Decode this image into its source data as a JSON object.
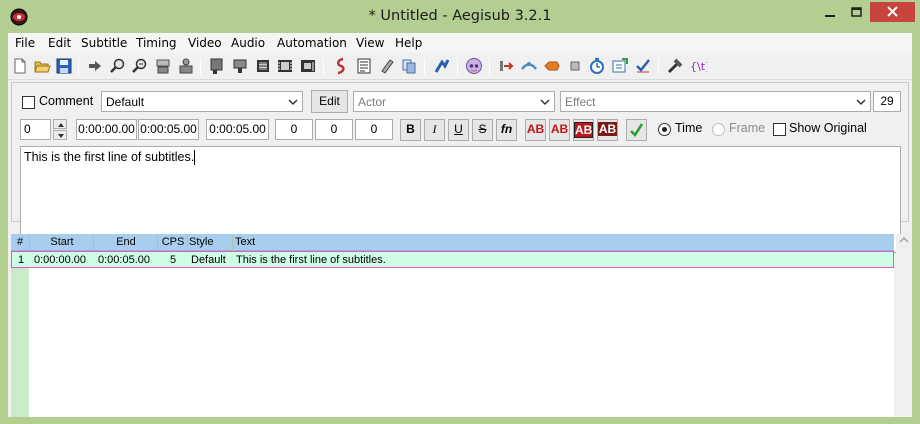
{
  "window": {
    "title": "* Untitled - Aegisub 3.2.1",
    "accent": "#b2ce91",
    "close_color": "#c7453c"
  },
  "menu": {
    "items": [
      "File",
      "Edit",
      "Subtitle",
      "Timing",
      "Video",
      "Audio",
      "Automation",
      "View",
      "Help"
    ]
  },
  "toolbar": {
    "icons": [
      "new-file-icon",
      "open-folder-icon",
      "save-icon",
      "jump-to-icon",
      "zoom-in-icon",
      "zoom-out-icon",
      "snap-start-icon",
      "snap-end-icon",
      "styles-manager-icon",
      "properties-icon",
      "attachments-icon",
      "fonts-collector-icon",
      "spell-check-icon",
      "shift-times-icon",
      "translation-icon",
      "resample-icon",
      "kanji-timer-icon",
      "visual-typesetting-icon",
      "timing-post-icon",
      "automation-icon",
      "options-icon"
    ]
  },
  "editbox": {
    "comment_label": "Comment",
    "comment_checked": false,
    "style_value": "Default",
    "edit_label": "Edit",
    "actor_placeholder": "Actor",
    "effect_placeholder": "Effect",
    "char_count": "29",
    "layer": "0",
    "start_time": "0:00:00.00",
    "end_time": "0:00:05.00",
    "duration": "0:00:05.00",
    "margin_left": "0",
    "margin_right": "0",
    "margin_vertical": "0",
    "bold_label": "B",
    "italic_label": "I",
    "underline_label": "U",
    "strike_label": "S",
    "font_label": "fn",
    "color_labels": [
      "AB",
      "AB",
      "AB",
      "AB"
    ],
    "time_label": "Time",
    "frame_label": "Frame",
    "show_original_label": "Show Original",
    "time_selected": true,
    "text": "This is the first line of subtitles."
  },
  "grid": {
    "headers": [
      "#",
      "Start",
      "End",
      "CPS",
      "Style",
      "Text"
    ],
    "rows": [
      {
        "num": "1",
        "start": "0:00:00.00",
        "end": "0:00:05.00",
        "cps": "5",
        "style": "Default",
        "text": "This is the first line of subtitles."
      }
    ],
    "header_color": "#a9cdee",
    "gutter_color": "#c8ebc8",
    "row_color": "#cefde5",
    "selected_border": "#e256c6"
  }
}
